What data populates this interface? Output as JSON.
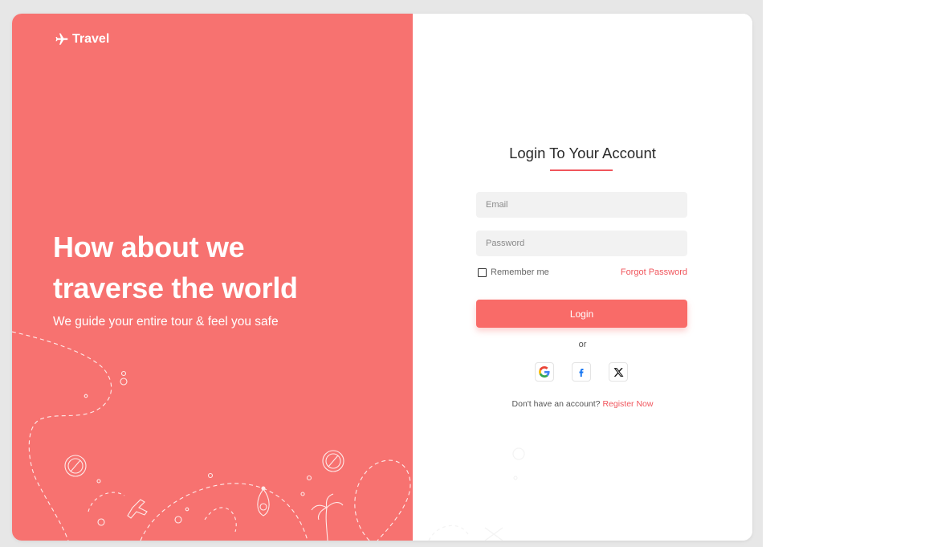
{
  "brand": {
    "name": "Travel",
    "icon": "airplane-icon"
  },
  "hero": {
    "title_line1": "How about we",
    "title_line2": "traverse the world",
    "subtitle": "We guide your entire tour & feel you safe"
  },
  "login": {
    "title": "Login To Your Account",
    "email_placeholder": "Email",
    "password_placeholder": "Password",
    "remember_label": "Remember me",
    "forgot_label": "Forgot Password",
    "button_label": "Login",
    "or_label": "or",
    "social": [
      {
        "name": "Google",
        "icon": "google-icon"
      },
      {
        "name": "Facebook",
        "icon": "facebook-icon"
      },
      {
        "name": "X",
        "icon": "x-icon"
      }
    ],
    "register_prompt": "Don't have an account?",
    "register_link": "Register Now"
  },
  "colors": {
    "brand": "#f77270",
    "accent": "#f0555c",
    "button": "#f96b68",
    "input_bg": "#f2f2f2",
    "backdrop": "#e7e7e7"
  }
}
